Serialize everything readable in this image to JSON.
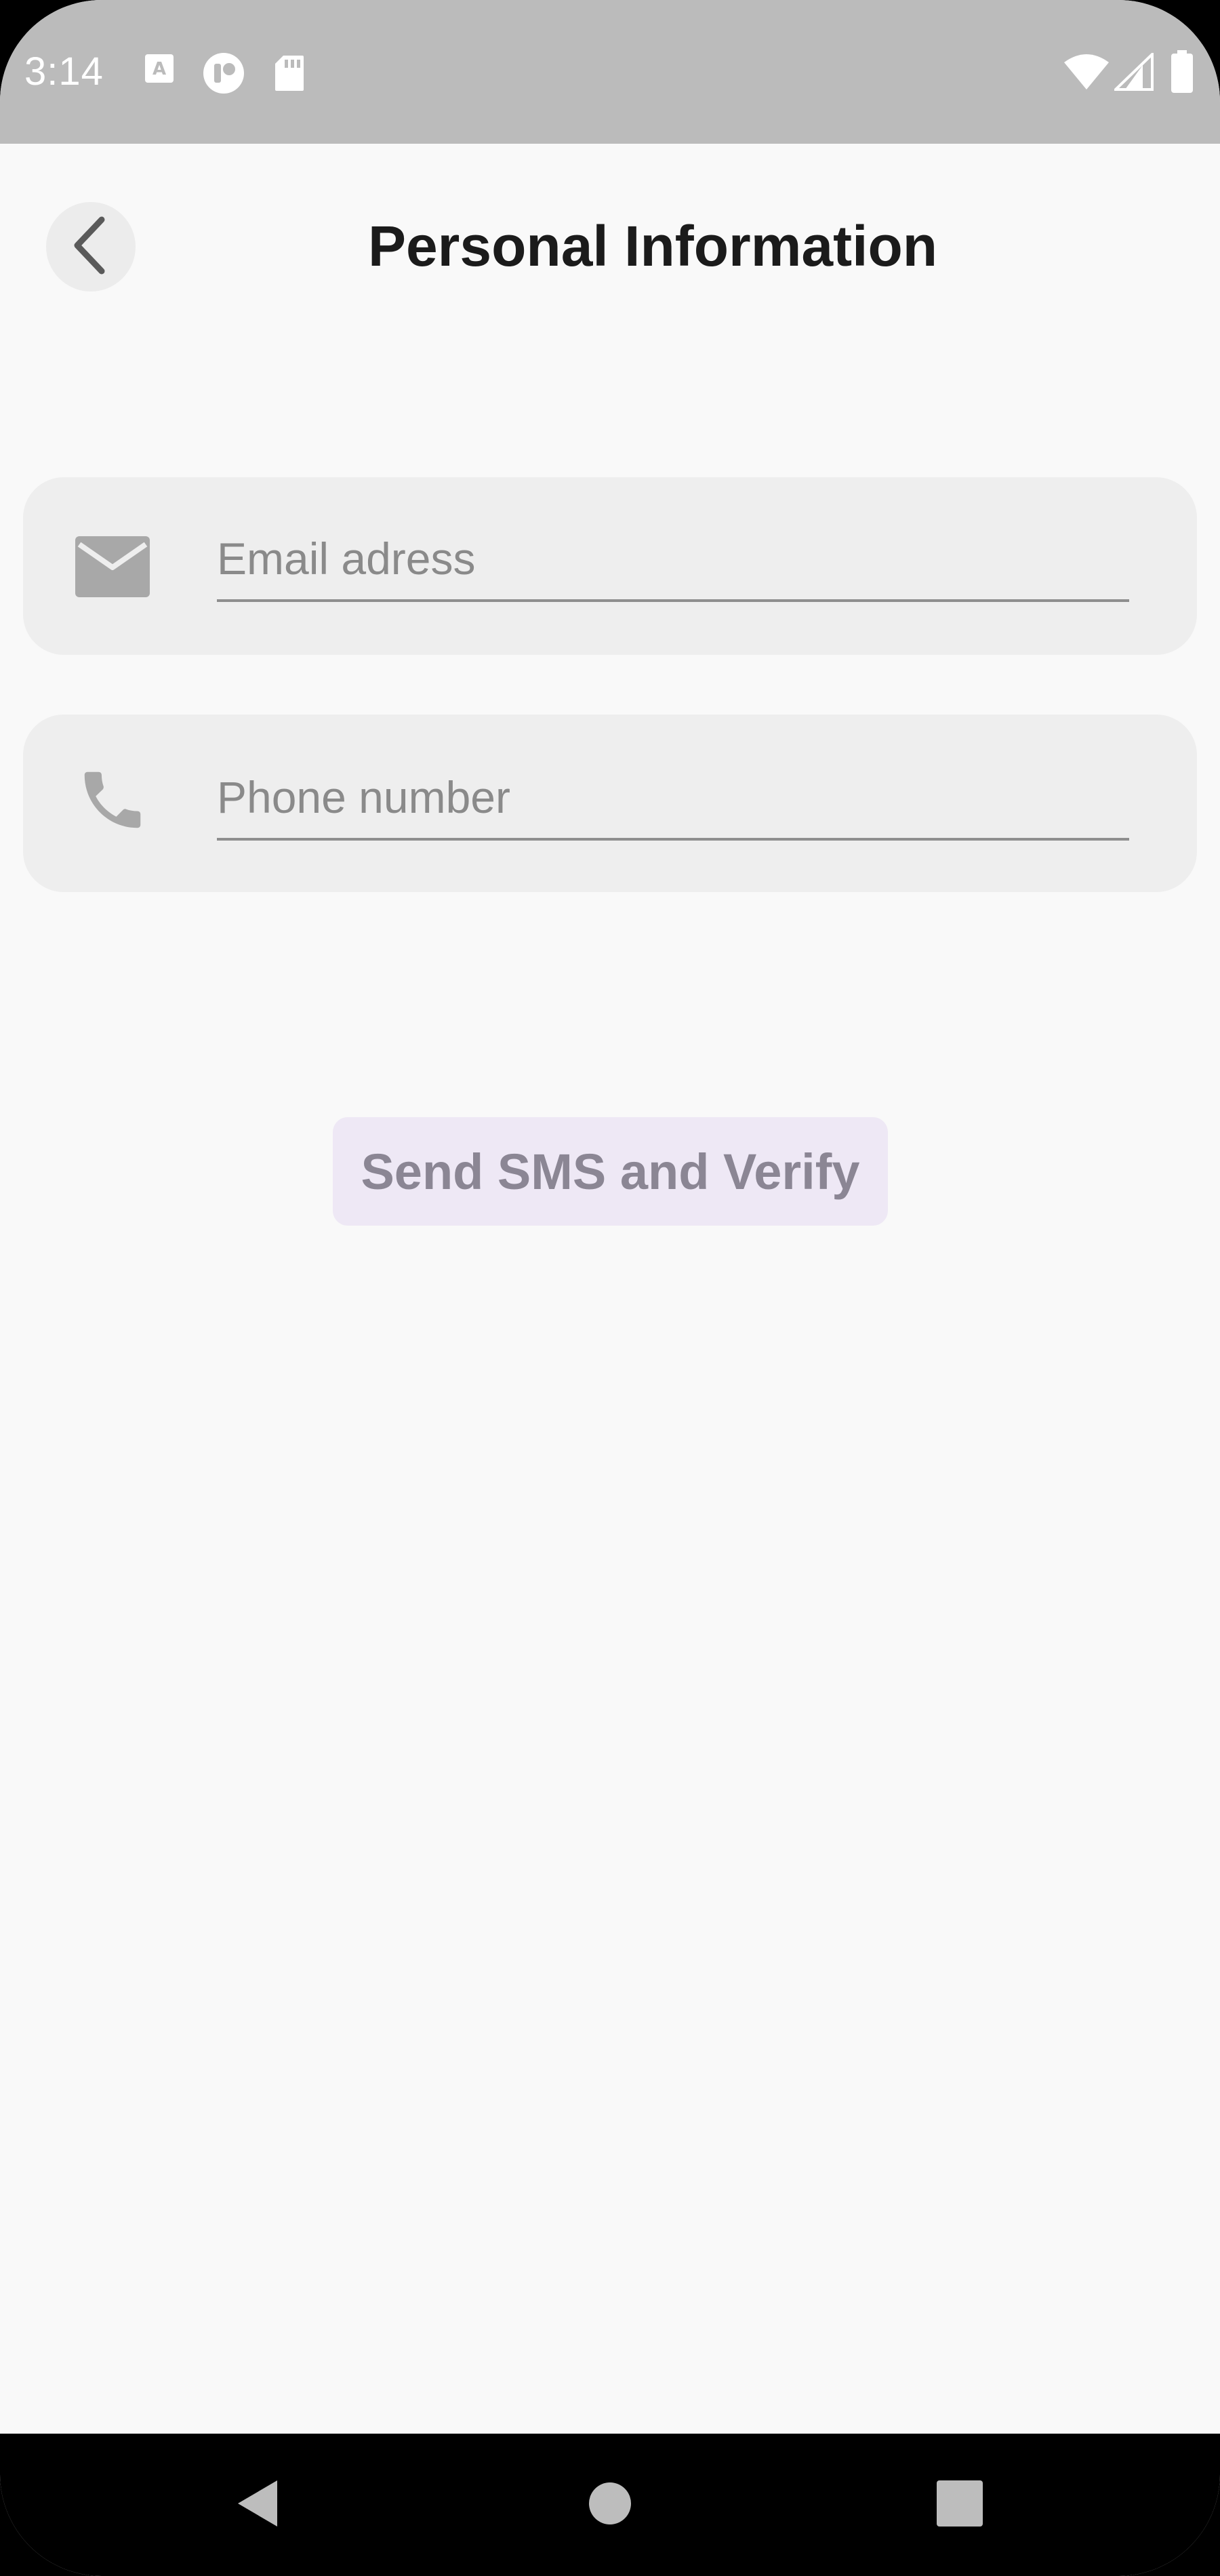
{
  "status_bar": {
    "time": "3:14",
    "icons": [
      "keyboard-a-icon",
      "app-notification-icon",
      "sd-card-icon",
      "wifi-icon",
      "signal-icon",
      "battery-icon"
    ]
  },
  "app_bar": {
    "title": "Personal Information",
    "back_icon": "chevron-left-icon"
  },
  "form": {
    "email": {
      "icon": "mail-icon",
      "placeholder": "Email adress",
      "value": ""
    },
    "phone": {
      "icon": "phone-icon",
      "placeholder": "Phone number",
      "value": ""
    },
    "submit_label": "Send SMS and Verify"
  },
  "nav_bar": {
    "items": [
      "back-triangle-icon",
      "home-circle-icon",
      "recents-square-icon"
    ]
  },
  "colors": {
    "status_bar": "#bbbbbb",
    "background": "#f9f9f9",
    "field_background": "#eeeeee",
    "button_background": "#eee8f5",
    "button_text": "#8b8694",
    "nav_bar": "#000000"
  }
}
